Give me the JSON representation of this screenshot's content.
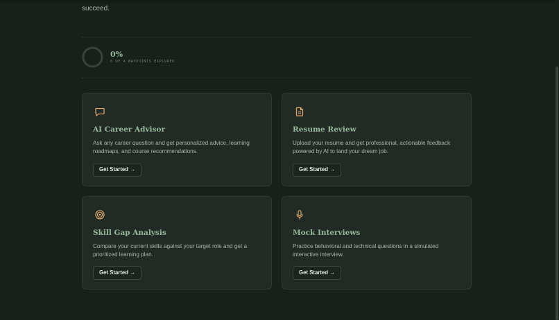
{
  "intro": {
    "tail_text": "succeed."
  },
  "progress": {
    "percent_label": "0%",
    "caption": "0 OF 4 WAYPOINTS EXPLORED",
    "fraction_complete": 0
  },
  "colors": {
    "background": "#18201b",
    "card_background": "#212a24",
    "title_green": "#95b99a",
    "icon_orange": "#d9a46c"
  },
  "cards": [
    {
      "icon": "chat-bubble-icon",
      "title": "AI Career Advisor",
      "description": "Ask any career question and get personalized advice, learning roadmaps, and course recommendations.",
      "button_label": "Get Started →"
    },
    {
      "icon": "document-icon",
      "title": "Resume Review",
      "description": "Upload your resume and get professional, actionable feedback powered by AI to land your dream job.",
      "button_label": "Get Started →"
    },
    {
      "icon": "target-icon",
      "title": "Skill Gap Analysis",
      "description": "Compare your current skills against your target role and get a prioritized learning plan.",
      "button_label": "Get Started →"
    },
    {
      "icon": "microphone-icon",
      "title": "Mock Interviews",
      "description": "Practice behavioral and technical questions in a simulated interactive interview.",
      "button_label": "Get Started →"
    }
  ]
}
